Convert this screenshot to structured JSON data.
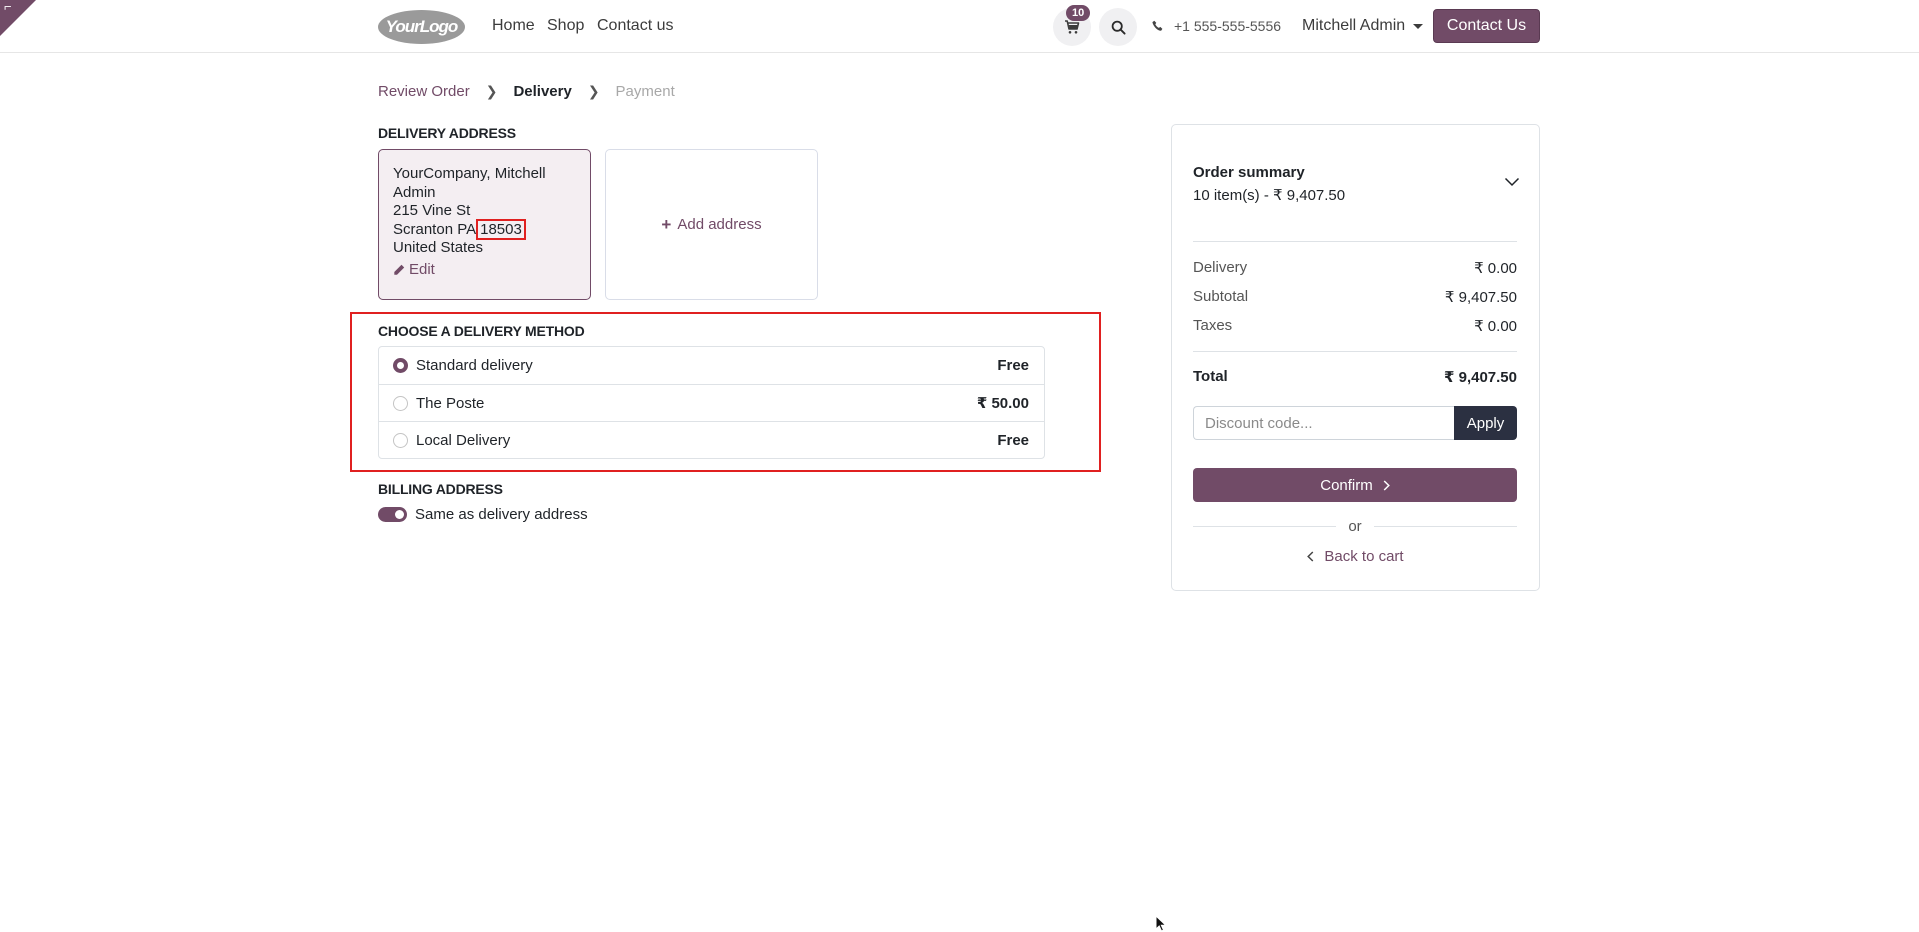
{
  "header": {
    "logo_text": "YourLogo",
    "nav": [
      "Home",
      "Shop",
      "Contact us"
    ],
    "cart_count": "10",
    "phone": "+1 555-555-5556",
    "user_name": "Mitchell Admin",
    "contact_button": "Contact Us"
  },
  "breadcrumb": {
    "step1": "Review Order",
    "step2": "Delivery",
    "step3": "Payment"
  },
  "delivery_address": {
    "title": "DELIVERY ADDRESS",
    "name": "YourCompany, Mitchell Admin",
    "street": "215 Vine St",
    "city_state": "Scranton PA",
    "zip": "18503",
    "country": "United States",
    "edit_label": "Edit",
    "add_label": "Add address"
  },
  "delivery_methods": {
    "title": "CHOOSE A DELIVERY METHOD",
    "items": [
      {
        "name": "Standard delivery",
        "price": "Free",
        "selected": true
      },
      {
        "name": "The Poste",
        "price": "₹ 50.00",
        "selected": false
      },
      {
        "name": "Local Delivery",
        "price": "Free",
        "selected": false
      }
    ]
  },
  "billing": {
    "title": "BILLING ADDRESS",
    "same_label": "Same as delivery address",
    "same_enabled": true
  },
  "summary": {
    "title": "Order summary",
    "subtitle": "10 item(s) -  ₹ 9,407.50",
    "delivery_label": "Delivery",
    "delivery_value": "₹ 0.00",
    "subtotal_label": "Subtotal",
    "subtotal_value": "₹ 9,407.50",
    "taxes_label": "Taxes",
    "taxes_value": "₹ 0.00",
    "total_label": "Total",
    "total_value": "₹ 9,407.50",
    "discount_placeholder": "Discount code...",
    "apply_label": "Apply",
    "confirm_label": "Confirm",
    "or_label": "or",
    "back_label": "Back to cart"
  },
  "colors": {
    "brand": "#714b67",
    "dark_button": "#2b3041",
    "highlight": "#e02020"
  }
}
